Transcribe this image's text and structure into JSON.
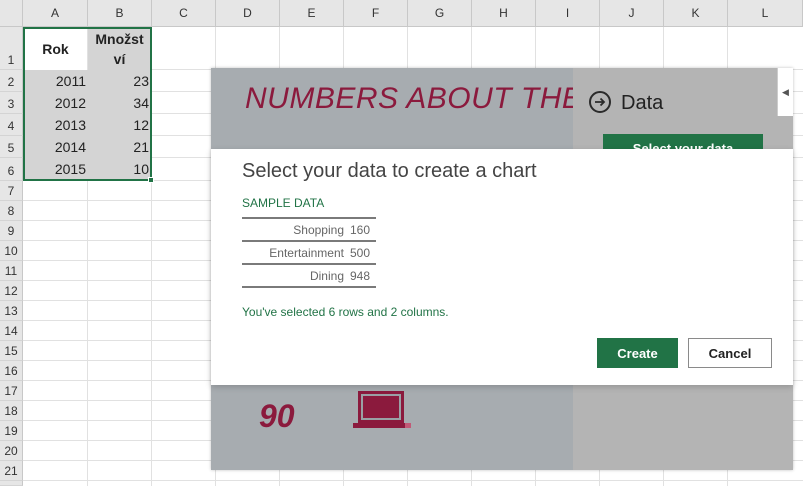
{
  "sheet": {
    "columns": [
      "A",
      "B",
      "C",
      "D",
      "E",
      "F",
      "G",
      "H",
      "I",
      "J",
      "K",
      "L"
    ],
    "rows": [
      "1",
      "2",
      "3",
      "4",
      "5",
      "6",
      "7",
      "8",
      "9",
      "10",
      "11",
      "12",
      "13",
      "14",
      "15",
      "16",
      "17",
      "18",
      "19",
      "20",
      "21"
    ],
    "header": {
      "a1": "Rok",
      "b1": "Množst ví"
    },
    "data": [
      {
        "rok": "2011",
        "mnozstvi": "23"
      },
      {
        "rok": "2012",
        "mnozstvi": "34"
      },
      {
        "rok": "2013",
        "mnozstvi": "12"
      },
      {
        "rok": "2014",
        "mnozstvi": "21"
      },
      {
        "rok": "2015",
        "mnozstvi": "10"
      }
    ],
    "selection_color": "#217346"
  },
  "pane": {
    "title": "NUMBERS ABOUT THE A",
    "data_label": "Data",
    "select_button": "Select your data",
    "big_number": "90",
    "arrow_icon": "arrow-circle-right-icon",
    "laptop_icon": "laptop-icon",
    "accent_color": "#8b1a3d"
  },
  "dialog": {
    "title": "Select your data to create a chart",
    "sample_label": "SAMPLE DATA",
    "sample_rows": [
      {
        "name": "Shopping",
        "value": "160"
      },
      {
        "name": "Entertainment",
        "value": "500"
      },
      {
        "name": "Dining",
        "value": "948"
      }
    ],
    "selected_message": "You've selected 6 rows and 2 columns.",
    "create_label": "Create",
    "cancel_label": "Cancel"
  }
}
